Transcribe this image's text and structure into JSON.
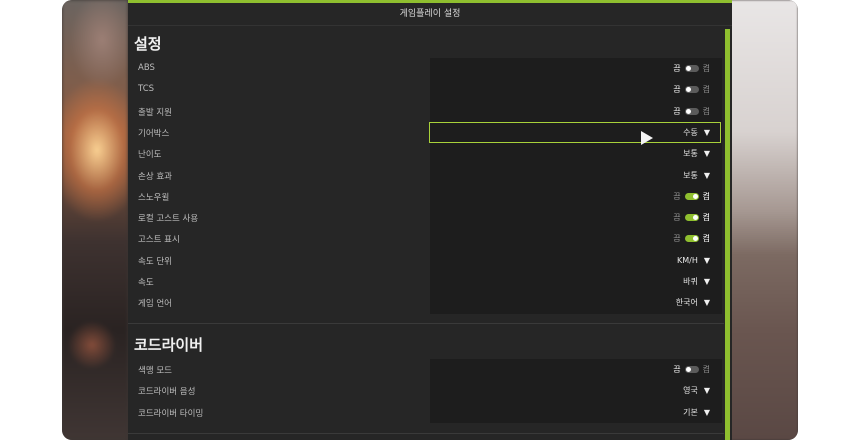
{
  "panel": {
    "title": "게임플레이 설정"
  },
  "sections": [
    {
      "title": "설정",
      "rows": [
        {
          "label": "ABS",
          "type": "toggle",
          "state": "off",
          "off_label": "끔",
          "on_label": "켬"
        },
        {
          "label": "TCS",
          "type": "toggle",
          "state": "off",
          "off_label": "끔",
          "on_label": "켬"
        },
        {
          "label": "출발 지원",
          "type": "toggle",
          "state": "off",
          "off_label": "끔",
          "on_label": "켬"
        },
        {
          "label": "기어박스",
          "type": "dropdown",
          "value": "수동"
        },
        {
          "label": "난이도",
          "type": "dropdown",
          "value": "보통"
        },
        {
          "label": "손상 효과",
          "type": "dropdown",
          "value": "보통"
        },
        {
          "label": "스노우윌",
          "type": "toggle",
          "state": "on",
          "off_label": "끔",
          "on_label": "켬"
        },
        {
          "label": "로컬 고스트 사용",
          "type": "toggle",
          "state": "on",
          "off_label": "끔",
          "on_label": "켬"
        },
        {
          "label": "고스트 표시",
          "type": "toggle",
          "state": "on",
          "off_label": "끔",
          "on_label": "켬"
        },
        {
          "label": "속도 단위",
          "type": "dropdown",
          "value": "KM/H"
        },
        {
          "label": "속도",
          "type": "dropdown",
          "value": "바퀴"
        },
        {
          "label": "게임 언어",
          "type": "dropdown",
          "value": "한국어"
        }
      ]
    },
    {
      "title": "코드라이버",
      "rows": [
        {
          "label": "색맹 모드",
          "type": "toggle",
          "state": "off",
          "off_label": "끔",
          "on_label": "켬"
        },
        {
          "label": "코드라이버 음성",
          "type": "dropdown",
          "value": "영국"
        },
        {
          "label": "코드라이버 타이밍",
          "type": "dropdown",
          "value": "기본"
        }
      ]
    }
  ],
  "colors": {
    "accent": "#8fbf2f",
    "panel_bg": "#262626",
    "value_bg": "#1d1d1d"
  }
}
